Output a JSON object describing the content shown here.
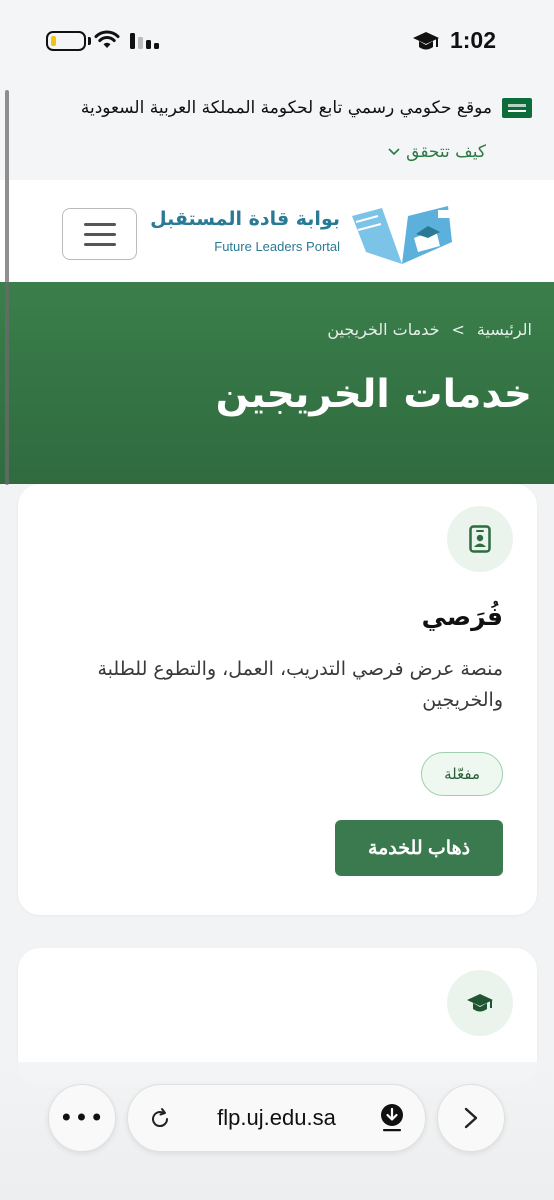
{
  "status_bar": {
    "time": "1:02",
    "icons": [
      "battery-icon",
      "wifi-icon",
      "signal-icon",
      "graduation-cap-icon"
    ]
  },
  "gov_banner": {
    "text": "موقع حكومي رسمي تابع لحكومة المملكة العربية السعودية",
    "verify_label": "كيف تتحقق"
  },
  "header": {
    "logo_ar": "بوابة قادة المستقبل",
    "logo_en": "Future Leaders Portal"
  },
  "hero": {
    "breadcrumb": {
      "home": "الرئيسية",
      "separator": ">",
      "current": "خدمات الخريجين"
    },
    "title": "خدمات الخريجين"
  },
  "cards": [
    {
      "icon": "id-badge-icon",
      "title": "فُرَصي",
      "description": "منصة عرض فرصي التدريب، العمل، والتطوع للطلبة والخريجين",
      "status": "مفعّلة",
      "cta": "ذهاب للخدمة"
    },
    {
      "icon": "graduation-cap-icon"
    }
  ],
  "browser": {
    "url": "flp.uj.edu.sa",
    "more_label": "•••"
  },
  "colors": {
    "primary_green": "#3b7a4e",
    "hero_green": "#2f6b3f",
    "logo_blue": "#2a7a96",
    "badge_bg": "#eef7f0"
  }
}
